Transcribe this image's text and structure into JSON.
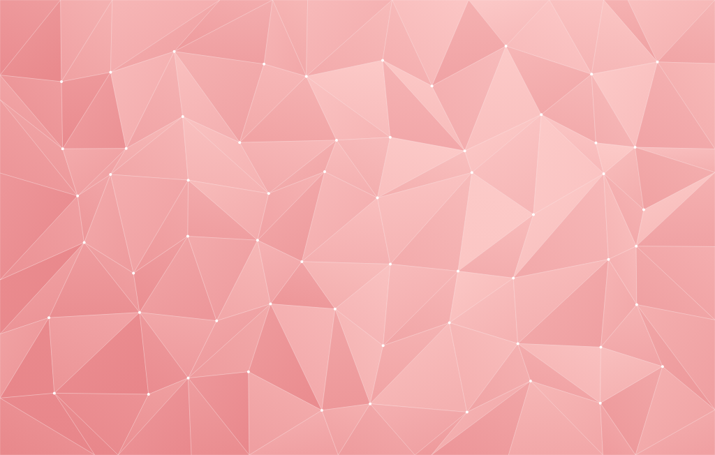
{
  "background": {
    "kind": "low-poly",
    "vertex_dots": true
  }
}
